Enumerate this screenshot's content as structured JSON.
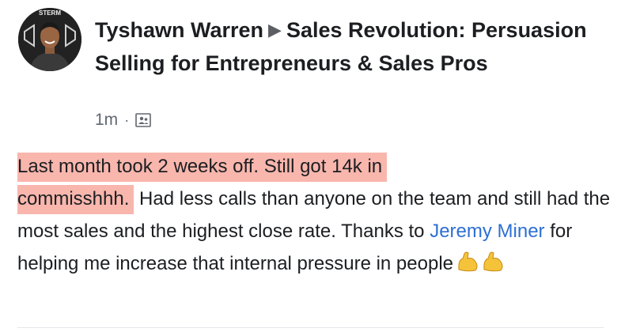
{
  "post": {
    "author": "Tyshawn Warren",
    "group": "Sales Revolution: Persuasion Selling for Entrepreneurs & Sales Pros",
    "timestamp": "1m",
    "separator": "·",
    "privacy_icon": "group-privacy-icon",
    "avatar_badge_text": "STERM",
    "body": {
      "highlight_line1": "Last month took 2 weeks off. Still got 14k in",
      "highlight_line2": "commisshhh.",
      "text_after_highlight": " Had less calls than anyone on the team and still had the most sales and the highest close rate. Thanks to ",
      "mention": "Jeremy Miner",
      "text_after_mention": " for helping me increase that internal pressure in people",
      "emoji": "flexed-biceps-emoji x2"
    },
    "colors": {
      "highlight": "#f8b6ad",
      "mention": "#2d6fd4",
      "meta": "#606770"
    }
  }
}
